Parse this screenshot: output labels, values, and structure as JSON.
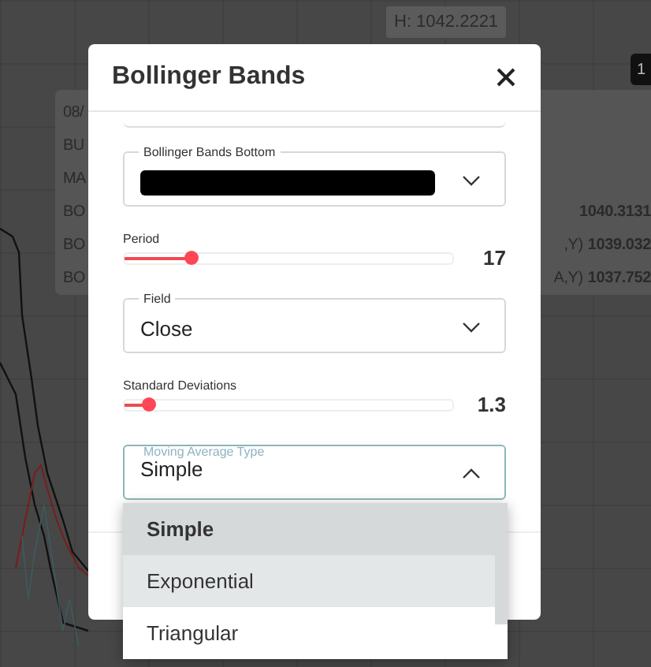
{
  "background": {
    "price_label": "H: 1042.2221",
    "badge": "1",
    "tooltip_rows": [
      {
        "left": "08/"
      },
      {
        "left": "BU"
      },
      {
        "left": "MA"
      },
      {
        "left": "BO",
        "value": "1040.3131"
      },
      {
        "left": "BO",
        "suffix": ",Y)",
        "value": "1039.032"
      },
      {
        "left": "BO",
        "suffix": "A,Y)",
        "value": "1037.752"
      }
    ]
  },
  "dialog": {
    "title": "Bollinger Bands",
    "fields": [
      {
        "kind": "select",
        "label": "Bollinger Bands Bottom",
        "redacted": true,
        "focused": false,
        "expanded": false
      },
      {
        "kind": "slider",
        "label": "Period",
        "level": 0.2,
        "reading": "17"
      },
      {
        "kind": "select",
        "label": "Field",
        "value": "Close",
        "focused": false,
        "expanded": false
      },
      {
        "kind": "slider",
        "label": "Standard Deviations",
        "level": 0.07,
        "reading": "1.3"
      },
      {
        "kind": "select",
        "label": "Moving Average Type",
        "value": "Simple",
        "focused": true,
        "expanded": true
      }
    ],
    "options": [
      {
        "label": "Simple",
        "selected": true,
        "highlighted": false
      },
      {
        "label": "Exponential",
        "selected": false,
        "highlighted": true
      },
      {
        "label": "Triangular",
        "selected": false,
        "highlighted": false
      }
    ]
  }
}
